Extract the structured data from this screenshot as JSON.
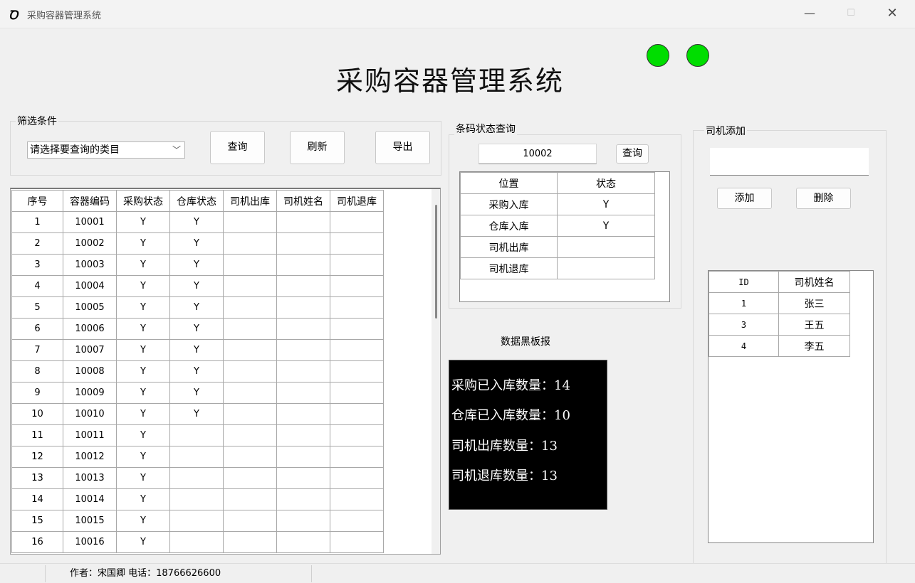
{
  "window": {
    "title": "采购容器管理系统",
    "icon": "app-logo",
    "minimize": "—",
    "maximize": "☐",
    "close": "✕"
  },
  "header": {
    "title": "采购容器管理系统",
    "indicator_color": "#00dd00"
  },
  "filter": {
    "group_label": "筛选条件",
    "select_value": "请选择要查询的类目",
    "query_label": "查询",
    "refresh_label": "刷新",
    "export_label": "导出"
  },
  "container_table": {
    "columns": [
      "序号",
      "容器编码",
      "采购状态",
      "仓库状态",
      "司机出库",
      "司机姓名",
      "司机退库"
    ],
    "rows": [
      [
        "1",
        "10001",
        "Y",
        "Y",
        "",
        "",
        ""
      ],
      [
        "2",
        "10002",
        "Y",
        "Y",
        "",
        "",
        ""
      ],
      [
        "3",
        "10003",
        "Y",
        "Y",
        "",
        "",
        ""
      ],
      [
        "4",
        "10004",
        "Y",
        "Y",
        "",
        "",
        ""
      ],
      [
        "5",
        "10005",
        "Y",
        "Y",
        "",
        "",
        ""
      ],
      [
        "6",
        "10006",
        "Y",
        "Y",
        "",
        "",
        ""
      ],
      [
        "7",
        "10007",
        "Y",
        "Y",
        "",
        "",
        ""
      ],
      [
        "8",
        "10008",
        "Y",
        "Y",
        "",
        "",
        ""
      ],
      [
        "9",
        "10009",
        "Y",
        "Y",
        "",
        "",
        ""
      ],
      [
        "10",
        "10010",
        "Y",
        "Y",
        "",
        "",
        ""
      ],
      [
        "11",
        "10011",
        "Y",
        "",
        "",
        "",
        ""
      ],
      [
        "12",
        "10012",
        "Y",
        "",
        "",
        "",
        ""
      ],
      [
        "13",
        "10013",
        "Y",
        "",
        "",
        "",
        ""
      ],
      [
        "14",
        "10014",
        "Y",
        "",
        "",
        "",
        ""
      ],
      [
        "15",
        "10015",
        "Y",
        "",
        "",
        "",
        ""
      ],
      [
        "16",
        "10016",
        "Y",
        "",
        "",
        "",
        ""
      ]
    ]
  },
  "barcode": {
    "group_label": "条码状态查询",
    "input_value": "10002",
    "query_label": "查询",
    "columns": [
      "位置",
      "状态"
    ],
    "rows": [
      [
        "采购入库",
        "Y"
      ],
      [
        "仓库入库",
        "Y"
      ],
      [
        "司机出库",
        ""
      ],
      [
        "司机退库",
        ""
      ]
    ]
  },
  "board": {
    "title": "数据黑板报",
    "lines": [
      "采购已入库数量：14",
      "仓库已入库数量：10",
      "司机出库数量：13",
      "司机退库数量：13"
    ]
  },
  "driver": {
    "group_label": "司机添加",
    "input_value": "",
    "add_label": "添加",
    "delete_label": "删除",
    "columns": [
      "ID",
      "司机姓名"
    ],
    "rows": [
      [
        "1",
        "张三"
      ],
      [
        "3",
        "王五"
      ],
      [
        "4",
        "李五"
      ]
    ]
  },
  "statusbar": {
    "text": "作者：宋国卿 电话：18766626600"
  }
}
